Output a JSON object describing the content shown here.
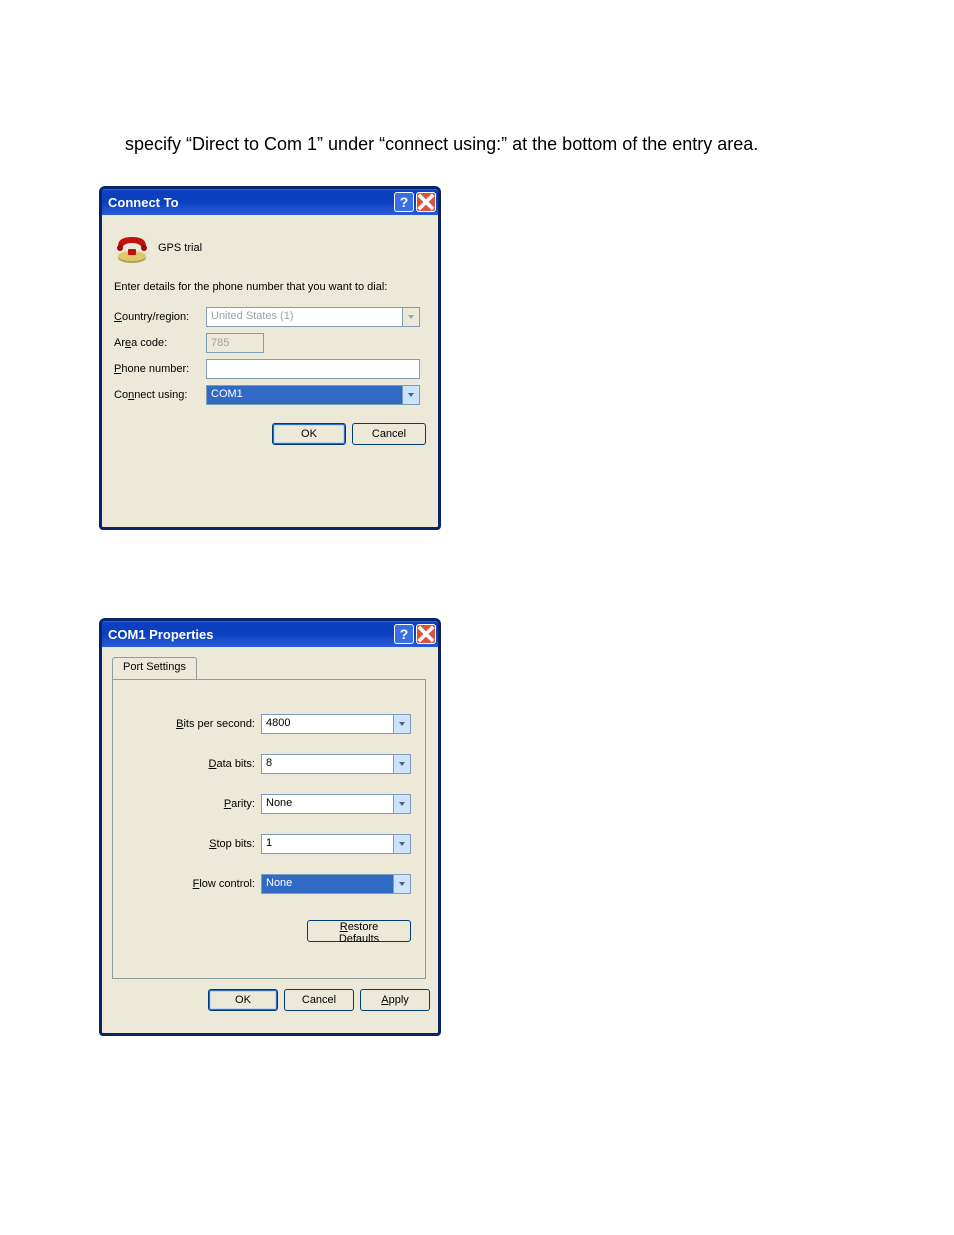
{
  "instruction_text": "specify “Direct to Com 1” under “connect using:” at the bottom of the entry area.",
  "dialog1": {
    "title": "Connect To",
    "icon_alt": "GPS trial",
    "prompt": "Enter details for the phone number that you want to dial:",
    "labels": {
      "country": "Country/region:",
      "area": "Area code:",
      "phone": "Phone number:",
      "connect": "Connect using:"
    },
    "values": {
      "country": "United States (1)",
      "area": "785",
      "phone": "",
      "connect": "COM1"
    },
    "buttons": {
      "ok": "OK",
      "cancel": "Cancel"
    }
  },
  "dialog2": {
    "title": "COM1 Properties",
    "tab": "Port Settings",
    "labels": {
      "bits": "Bits per second:",
      "data": "Data bits:",
      "parity": "Parity:",
      "stop": "Stop bits:",
      "flow": "Flow control:"
    },
    "values": {
      "bits": "4800",
      "data": "8",
      "parity": "None",
      "stop": "1",
      "flow": "None"
    },
    "buttons": {
      "restore": "Restore Defaults",
      "ok": "OK",
      "cancel": "Cancel",
      "apply": "Apply"
    }
  }
}
